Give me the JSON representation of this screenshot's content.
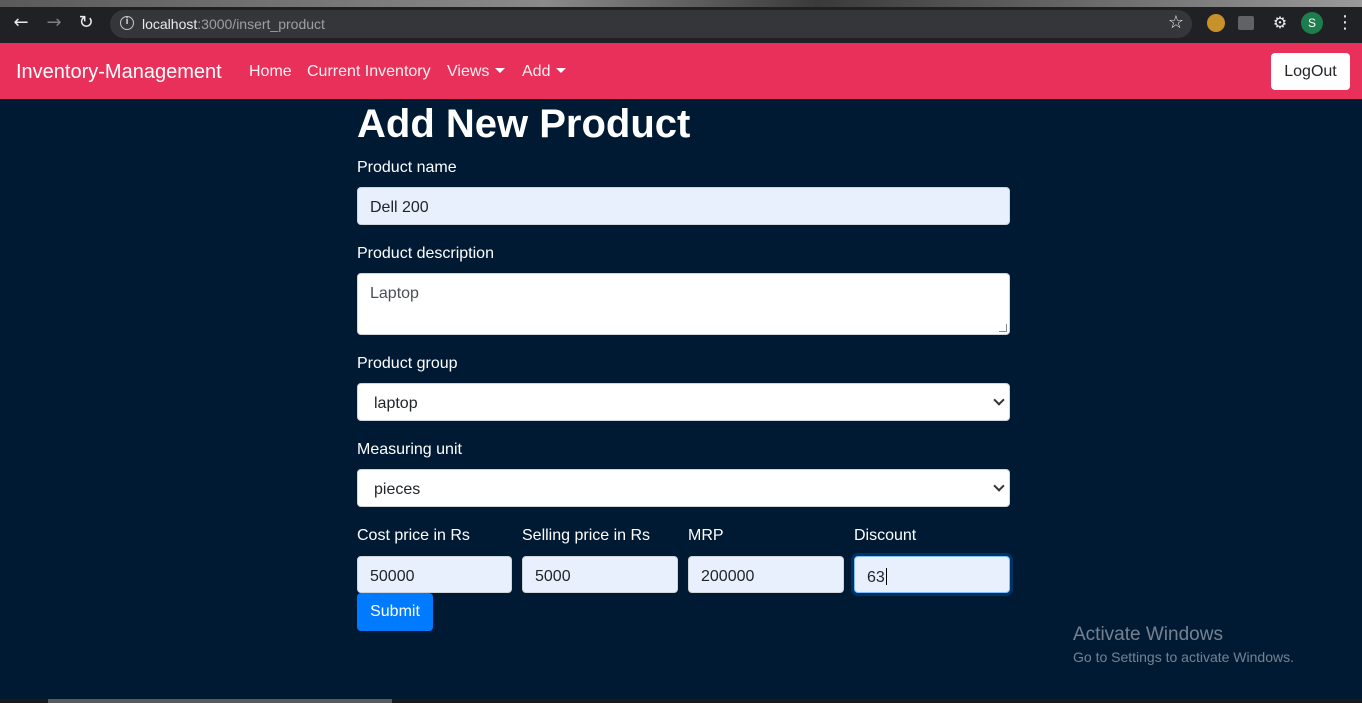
{
  "browser": {
    "url_host": "localhost",
    "url_path": ":3000/insert_product",
    "avatar_letter": "S"
  },
  "navbar": {
    "brand": "Inventory-Management",
    "links": [
      "Home",
      "Current Inventory",
      "Views",
      "Add"
    ],
    "logout": "LogOut"
  },
  "form": {
    "title": "Add New Product",
    "product_name_label": "Product name",
    "product_name_value": "Dell 200",
    "product_description_label": "Product description",
    "product_description_value": "Laptop",
    "product_group_label": "Product group",
    "product_group_value": "laptop",
    "measuring_unit_label": "Measuring unit",
    "measuring_unit_value": "pieces",
    "cost_price_label": "Cost price in Rs",
    "cost_price_value": "50000",
    "selling_price_label": "Selling price in Rs",
    "selling_price_value": "5000",
    "mrp_label": "MRP",
    "mrp_value": "200000",
    "discount_label": "Discount",
    "discount_value": "63",
    "submit": "Submit"
  },
  "watermark": {
    "line1": "Activate Windows",
    "line2": "Go to Settings to activate Windows."
  },
  "colors": {
    "navbar": "#e8305a",
    "page_background": "#001a33",
    "submit_button": "#007bff"
  }
}
